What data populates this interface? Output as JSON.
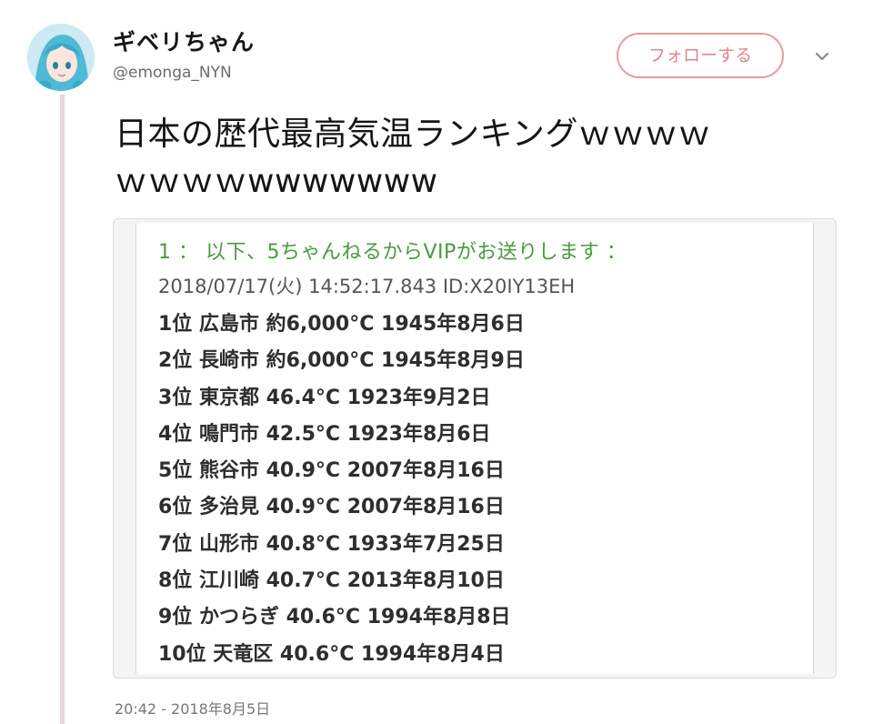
{
  "user": {
    "display_name": "ギベリちゃん",
    "handle": "@emonga_NYN",
    "avatar_icon": "anime-avatar-icon"
  },
  "actions": {
    "follow_label": "フォローする",
    "more_icon": "chevron-down-icon"
  },
  "tweet": {
    "text_line1": "日本の歴代最高気温ランキングｗｗｗｗ",
    "text_line2": "ｗｗｗｗwwwwwww",
    "timestamp": "20:42 - 2018年8月5日"
  },
  "embed": {
    "header": "1 ： 以下、5ちゃんねるからVIPがお送りします ：",
    "meta": "2018/07/17(火) 14:52:17.843 ID:X20IY13EH",
    "ranking": [
      "1位 広島市 約6,000°C 1945年8月6日",
      "2位 長崎市 約6,000°C 1945年8月9日",
      "3位 東京都 46.4°C 1923年9月2日",
      "4位 鳴門市 42.5°C 1923年8月6日",
      "5位 熊谷市 40.9°C 2007年8月16日",
      "6位 多治見 40.9°C 2007年8月16日",
      "7位 山形市 40.8°C 1933年7月25日",
      "8位 江川崎 40.7°C 2013年8月10日",
      "9位 かつらぎ 40.6°C 1994年8月8日",
      "10位 天竜区 40.6°C 1994年8月4日"
    ]
  },
  "colors": {
    "follow_accent": "#e08690",
    "header_green": "#4b9a42",
    "thread_line": "#e4d9dd"
  }
}
